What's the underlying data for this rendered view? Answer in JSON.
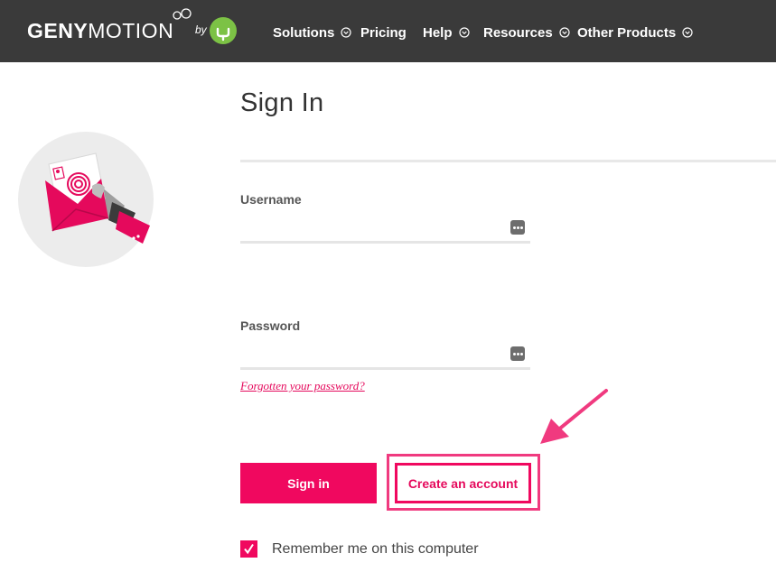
{
  "header": {
    "logo": {
      "part1": "GENY",
      "part2": "MOTION",
      "by": "by"
    },
    "nav": [
      {
        "label": "Solutions",
        "has_dropdown": true
      },
      {
        "label": "Pricing",
        "has_dropdown": false
      },
      {
        "label": "Help",
        "has_dropdown": true
      },
      {
        "label": "Resources",
        "has_dropdown": true
      },
      {
        "label": "Other Products",
        "has_dropdown": true
      }
    ]
  },
  "form": {
    "title": "Sign In",
    "username": {
      "label": "Username",
      "value": "",
      "placeholder": ""
    },
    "password": {
      "label": "Password",
      "value": "",
      "placeholder": ""
    },
    "forgot_link": "Forgotten your password?",
    "signin_button": "Sign in",
    "create_account_button": "Create an account",
    "remember": {
      "label": "Remember me on this computer",
      "checked": true
    }
  },
  "colors": {
    "header_bg": "#3a3a3a",
    "accent": "#f0085f",
    "brand_badge": "#7cc245"
  },
  "icons": {
    "nav_dropdown": "chevron-down-circle-icon",
    "field_action": "password-manager-icon",
    "illustration": "fingerprint-envelope-icon",
    "annotation": "pointer-arrow-icon"
  }
}
